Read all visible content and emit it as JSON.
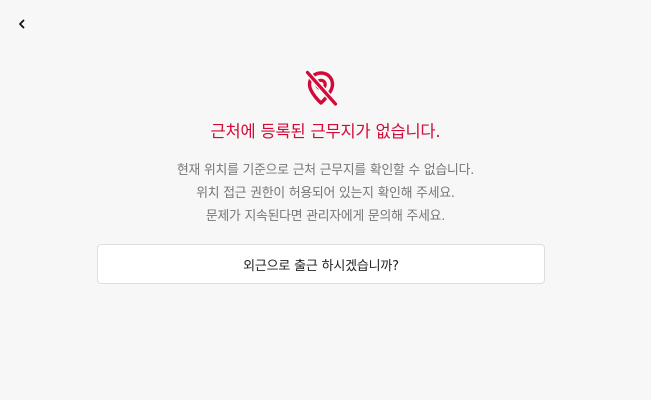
{
  "header": {
    "back_icon": "chevron-left-icon"
  },
  "main": {
    "icon": "location-off-icon",
    "title": "근처에 등록된 근무지가 없습니다.",
    "messages": [
      "현재 위치를 기준으로 근처 근무지를 확인할 수 없습니다.",
      "위치 접근 권한이 허용되어 있는지 확인해 주세요.",
      "문제가 지속된다면 관리자에게 문의해 주세요."
    ],
    "outside_checkin_label": "외근으로 출근 하시겠습니까?"
  },
  "colors": {
    "accent": "#d20a37",
    "background": "#f7f7f7",
    "secondary_text": "#767676"
  }
}
